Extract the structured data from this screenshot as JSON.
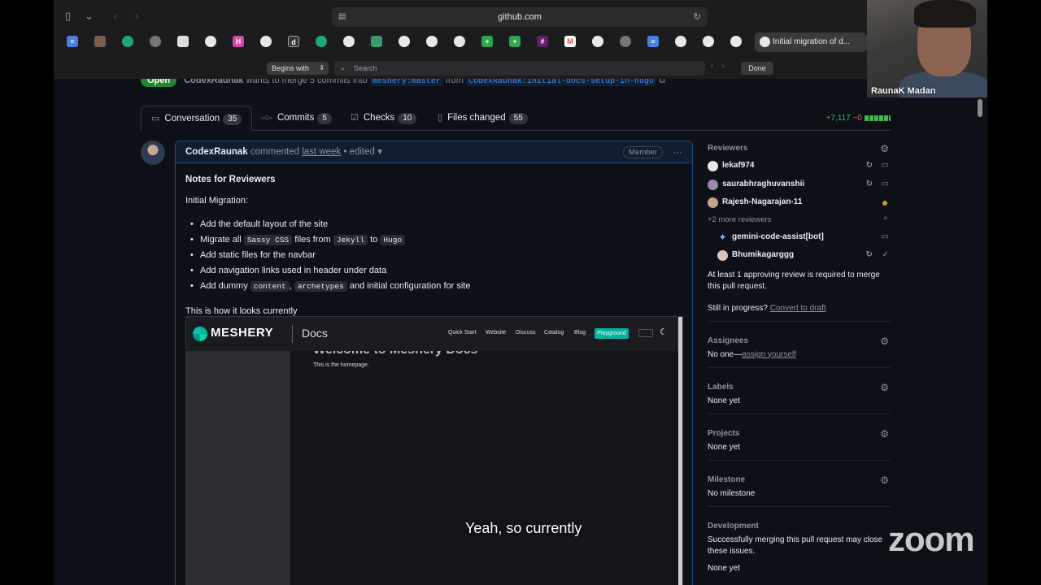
{
  "browser": {
    "url": "github.com",
    "active_tab_title": "Initial migration of d...",
    "find_mode": "Begins with",
    "find_placeholder": "Search",
    "find_done": "Done"
  },
  "webcam": {
    "name": "RaunaK Madan"
  },
  "pr": {
    "status": "Open",
    "author": "CodexRaunak",
    "meta_text": "wants to merge 5 commits into",
    "base_branch": "meshery:master",
    "from_word": "from",
    "head_branch": "CodexRaunak:initial-docs-setup-in-hugo"
  },
  "tabs": [
    {
      "label": "Conversation",
      "count": "35"
    },
    {
      "label": "Commits",
      "count": "5"
    },
    {
      "label": "Checks",
      "count": "10"
    },
    {
      "label": "Files changed",
      "count": "55"
    }
  ],
  "diffstat": {
    "plus": "+7,117",
    "minus": "−0"
  },
  "comment": {
    "author": "CodexRaunak",
    "verb": "commented",
    "when": "last week",
    "edited": "• edited",
    "role": "Member",
    "heading": "Notes for Reviewers",
    "intro": "Initial Migration:",
    "items": [
      {
        "text": "Add the default layout of the site"
      },
      {
        "pre": "Migrate all",
        "code1": "Sassy CSS",
        "mid": "files from",
        "code2": "Jekyll",
        "mid2": "to",
        "code3": "Hugo"
      },
      {
        "text": "Add static files for the navbar"
      },
      {
        "text": "Add navigation links used in header under data"
      },
      {
        "pre": "Add dummy",
        "code1": "content",
        "mid": ",",
        "code2": "archetypes",
        "post": "and initial configuration for site"
      }
    ],
    "outro": "This is how it looks currently"
  },
  "preview": {
    "brand": "MESHERY",
    "docs": "Docs",
    "nav": [
      "Quick Start",
      "Website",
      "Discuss",
      "Catalog",
      "Blog"
    ],
    "playground": "Playground",
    "title": "Welcome to Meshery Docs",
    "subtitle": "This is the homepage."
  },
  "caption": "Yeah, so currently",
  "sidebar": {
    "reviewers_title": "Reviewers",
    "reviewers": [
      {
        "name": "lekaf974"
      },
      {
        "name": "saurabhraghuvanshii"
      },
      {
        "name": "Rajesh-Nagarajan-11"
      }
    ],
    "more_reviewers": "+2 more reviewers",
    "extra_reviewers": [
      {
        "name": "gemini-code-assist[bot]"
      },
      {
        "name": "Bhumikagarggg"
      }
    ],
    "approval_note": "At least 1 approving review is required to merge this pull request.",
    "progress_q": "Still in progress?",
    "convert_link": "Convert to draft",
    "assignees_title": "Assignees",
    "assignees_none": "No one—",
    "assign_yourself": "assign yourself",
    "labels_title": "Labels",
    "labels_value": "None yet",
    "projects_title": "Projects",
    "projects_value": "None yet",
    "milestone_title": "Milestone",
    "milestone_value": "No milestone",
    "development_title": "Development",
    "development_note": "Successfully merging this pull request may close these issues.",
    "development_value": "None yet"
  },
  "watermark": "zoom"
}
